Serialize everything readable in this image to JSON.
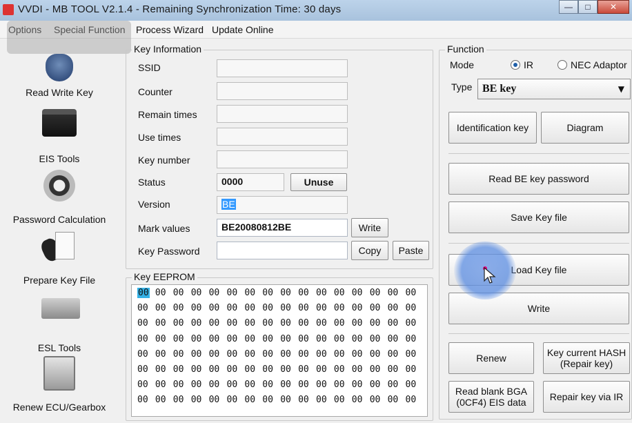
{
  "window": {
    "title": "VVDI - MB TOOL V2.1.4 - Remaining Synchronization Time: 30 days",
    "minimize": "—",
    "maximize": "□",
    "close": "✕"
  },
  "menu": [
    "Options",
    "Special Function",
    "Process Wizard",
    "Update Online"
  ],
  "sidebar": [
    {
      "label": "Read Write Key",
      "icon": "smart-key-icon"
    },
    {
      "label": "EIS Tools",
      "icon": "eis-module-icon"
    },
    {
      "label": "Password Calculation",
      "icon": "password-gear-icon"
    },
    {
      "label": "Prepare Key File",
      "icon": "key-file-icon"
    },
    {
      "label": "ESL Tools",
      "icon": "esl-lock-icon"
    },
    {
      "label": "Renew ECU/Gearbox",
      "icon": "ecu-module-icon"
    }
  ],
  "key_info": {
    "title": "Key Information",
    "ssid_label": "SSID",
    "ssid_value": "",
    "counter_label": "Counter",
    "counter_value": "",
    "remain_label": "Remain times",
    "remain_value": "",
    "use_label": "Use times",
    "use_value": "",
    "keynum_label": "Key number",
    "keynum_value": "",
    "status_label": "Status",
    "status_value": "0000",
    "unuse_button": "Unuse",
    "version_label": "Version",
    "version_value": "BE",
    "mark_label": "Mark values",
    "mark_value": "BE20080812BE",
    "write_button": "Write",
    "password_label": "Key Password",
    "password_value": "",
    "copy_button": "Copy",
    "paste_button": "Paste"
  },
  "eeprom": {
    "title": "Key EEPROM",
    "rows": [
      [
        "00",
        "00",
        "00",
        "00",
        "00",
        "00",
        "00",
        "00",
        "00",
        "00",
        "00",
        "00",
        "00",
        "00",
        "00",
        "00"
      ],
      [
        "00",
        "00",
        "00",
        "00",
        "00",
        "00",
        "00",
        "00",
        "00",
        "00",
        "00",
        "00",
        "00",
        "00",
        "00",
        "00"
      ],
      [
        "00",
        "00",
        "00",
        "00",
        "00",
        "00",
        "00",
        "00",
        "00",
        "00",
        "00",
        "00",
        "00",
        "00",
        "00",
        "00"
      ],
      [
        "00",
        "00",
        "00",
        "00",
        "00",
        "00",
        "00",
        "00",
        "00",
        "00",
        "00",
        "00",
        "00",
        "00",
        "00",
        "00"
      ],
      [
        "00",
        "00",
        "00",
        "00",
        "00",
        "00",
        "00",
        "00",
        "00",
        "00",
        "00",
        "00",
        "00",
        "00",
        "00",
        "00"
      ],
      [
        "00",
        "00",
        "00",
        "00",
        "00",
        "00",
        "00",
        "00",
        "00",
        "00",
        "00",
        "00",
        "00",
        "00",
        "00",
        "00"
      ],
      [
        "00",
        "00",
        "00",
        "00",
        "00",
        "00",
        "00",
        "00",
        "00",
        "00",
        "00",
        "00",
        "00",
        "00",
        "00",
        "00"
      ],
      [
        "00",
        "00",
        "00",
        "00",
        "00",
        "00",
        "00",
        "00",
        "00",
        "00",
        "00",
        "00",
        "00",
        "00",
        "00",
        "00"
      ]
    ]
  },
  "function": {
    "title": "Function",
    "mode_label": "Mode",
    "mode_ir": "IR",
    "mode_nec": "NEC Adaptor",
    "selected_mode": "IR",
    "type_label": "Type",
    "type_value": "BE key",
    "identification_button": "Identification key",
    "diagram_button": "Diagram",
    "read_password_button": "Read BE key password",
    "save_key_button": "Save Key file",
    "load_key_button": "Load Key file",
    "write_button": "Write",
    "renew_button": "Renew",
    "key_hash_button": "Key current HASH (Repair key)",
    "read_blank_button": "Read blank BGA (0CF4) EIS data",
    "repair_ir_button": "Repair key via IR"
  }
}
